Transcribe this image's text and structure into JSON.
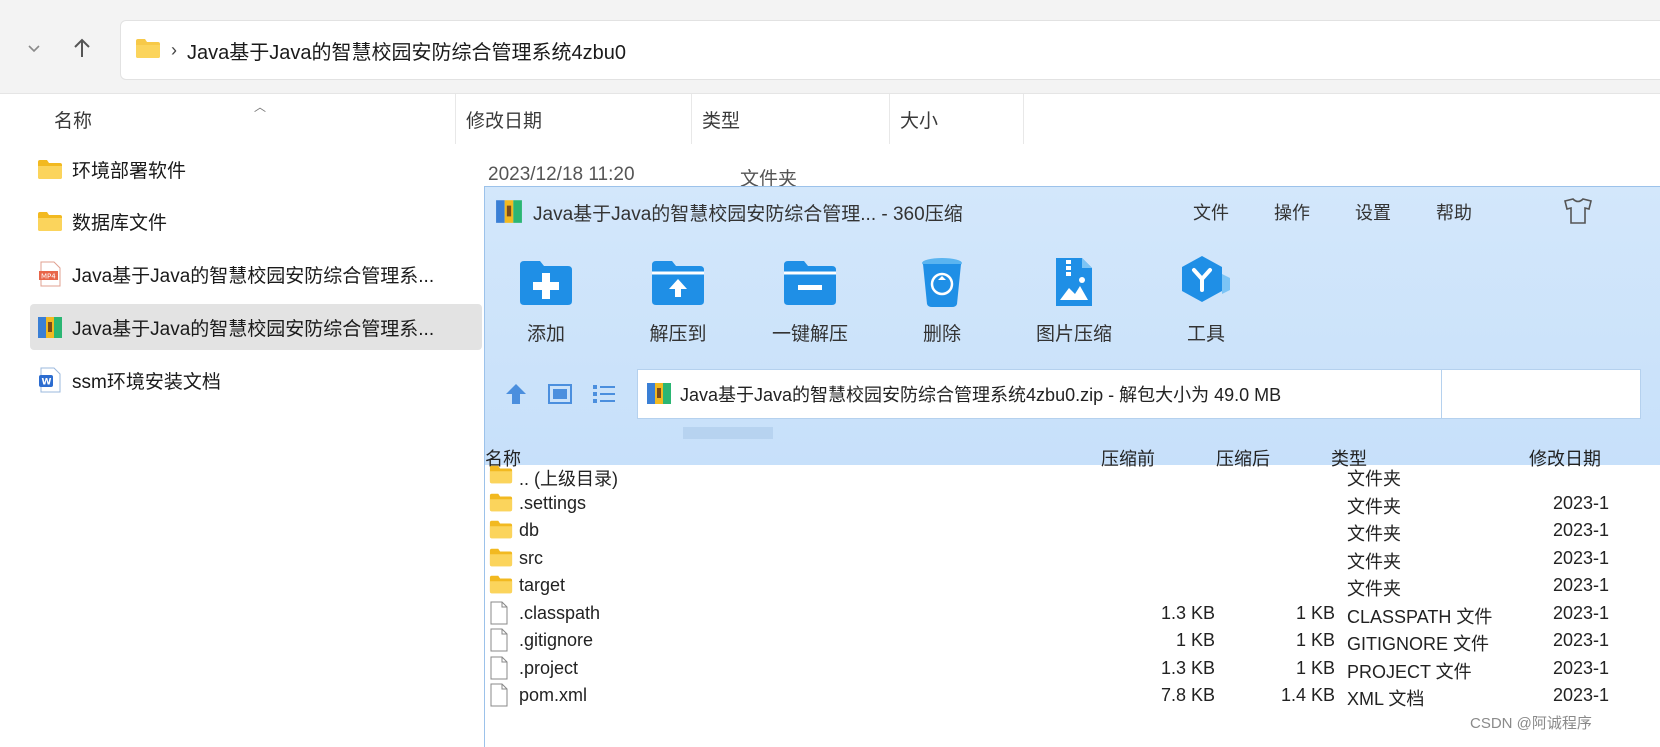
{
  "explorer": {
    "path": "Java基于Java的智慧校园安防综合管理系统4zbu0",
    "columns": {
      "name": "名称",
      "modified": "修改日期",
      "type": "类型",
      "size": "大小"
    },
    "files": [
      {
        "name": "环境部署软件",
        "date": "2023/12/18 11:20",
        "type": "文件夹",
        "icon": "folder-icon"
      },
      {
        "name": "数据库文件",
        "icon": "folder-icon"
      },
      {
        "name": "Java基于Java的智慧校园安防综合管理系...",
        "icon": "mp4-file-icon"
      },
      {
        "name": "Java基于Java的智慧校园安防综合管理系...",
        "icon": "zip-archive-icon",
        "selected": true
      },
      {
        "name": "ssm环境安装文档",
        "icon": "word-doc-icon"
      }
    ]
  },
  "zip": {
    "title": "Java基于Java的智慧校园安防综合管理... - 360压缩",
    "menu": [
      "文件",
      "操作",
      "设置",
      "帮助"
    ],
    "toolbar": [
      "添加",
      "解压到",
      "一键解压",
      "删除",
      "图片压缩",
      "工具"
    ],
    "path": "Java基于Java的智慧校园安防综合管理系统4zbu0.zip - 解包大小为 49.0 MB",
    "columns": {
      "name": "名称",
      "before": "压缩前",
      "after": "压缩后",
      "type": "类型",
      "modified": "修改日期"
    },
    "rows": [
      {
        "name": ".. (上级目录)",
        "before": "",
        "after": "",
        "type": "文件夹",
        "modified": "",
        "icon": "folder-icon"
      },
      {
        "name": ".settings",
        "before": "",
        "after": "",
        "type": "文件夹",
        "modified": "2023-1",
        "icon": "folder-icon"
      },
      {
        "name": "db",
        "before": "",
        "after": "",
        "type": "文件夹",
        "modified": "2023-1",
        "icon": "folder-icon"
      },
      {
        "name": "src",
        "before": "",
        "after": "",
        "type": "文件夹",
        "modified": "2023-1",
        "icon": "folder-icon"
      },
      {
        "name": "target",
        "before": "",
        "after": "",
        "type": "文件夹",
        "modified": "2023-1",
        "icon": "folder-icon"
      },
      {
        "name": ".classpath",
        "before": "1.3 KB",
        "after": "1 KB",
        "type": "CLASSPATH 文件",
        "modified": "2023-1",
        "icon": "file-icon"
      },
      {
        "name": ".gitignore",
        "before": "1 KB",
        "after": "1 KB",
        "type": "GITIGNORE 文件",
        "modified": "2023-1",
        "icon": "file-icon"
      },
      {
        "name": ".project",
        "before": "1.3 KB",
        "after": "1 KB",
        "type": "PROJECT 文件",
        "modified": "2023-1",
        "icon": "file-icon"
      },
      {
        "name": "pom.xml",
        "before": "7.8 KB",
        "after": "1.4 KB",
        "type": "XML 文档",
        "modified": "2023-1",
        "icon": "file-icon"
      }
    ]
  },
  "watermark": "CSDN @阿诚程序",
  "colors": {
    "folder": "#f7c948",
    "zip_bg": "#cfe4fa",
    "accent_blue": "#2b8fe6",
    "selected_row": "#e3e3e3"
  }
}
